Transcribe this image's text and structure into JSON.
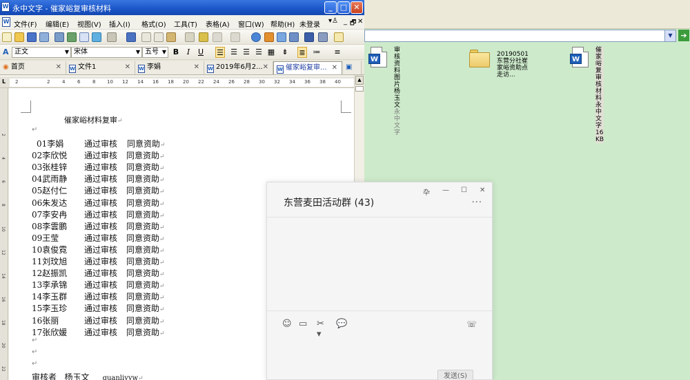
{
  "explorer": {
    "files": [
      {
        "name_line1": "审核资料图片  杨玉",
        "name_line2": "文",
        "sub": "永中文字"
      },
      {
        "name_line1": "20190501东营分社崔",
        "name_line2": "家峪资助点走访..."
      },
      {
        "name_line1": "催家峪复审核材料",
        "name_line2": "永中文字",
        "sub": "16 KB"
      }
    ]
  },
  "wp": {
    "title": "永中文字 - 催家峪复审核材料",
    "menu": [
      "文件(F)",
      "编辑(E)",
      "视图(V)",
      "插入(I)",
      "格式(O)",
      "工具(T)",
      "表格(A)",
      "窗口(W)",
      "帮助(H)"
    ],
    "login": "未登录",
    "style_value": "正文",
    "font_value": "宋体",
    "size_value": "五号",
    "tabs": [
      {
        "label": "首页"
      },
      {
        "label": "文件1"
      },
      {
        "label": "李娟"
      },
      {
        "label": "2019年6月2..."
      },
      {
        "label": "催家峪复审..."
      }
    ],
    "ruler_numbers": [
      "2",
      "2",
      "4",
      "6",
      "8",
      "10",
      "12",
      "14",
      "16",
      "18",
      "20",
      "22",
      "24",
      "26",
      "28",
      "30",
      "32",
      "34",
      "36",
      "38",
      "40"
    ],
    "vruler_numbers": [
      "2",
      "4",
      "6",
      "8",
      "10",
      "12",
      "14",
      "16",
      "18",
      "20",
      "22"
    ],
    "document": {
      "heading": "催家峪材料复审",
      "rows": [
        {
          "no": "01",
          "name": "李娟",
          "status": "通过审核",
          "result": "同意资助"
        },
        {
          "no": "02",
          "name": "李欣悦",
          "status": "通过审核",
          "result": "同意资助"
        },
        {
          "no": "03",
          "name": "张桂锌",
          "status": "通过审核",
          "result": "同意资助"
        },
        {
          "no": "04",
          "name": "武雨静",
          "status": "通过审核",
          "result": "同意资助"
        },
        {
          "no": "05",
          "name": "赵付仁",
          "status": "通过审核",
          "result": "同意资助"
        },
        {
          "no": "06",
          "name": "朱发达",
          "status": "通过审核",
          "result": "同意资助"
        },
        {
          "no": "07",
          "name": "李安冉",
          "status": "通过审核",
          "result": "同意资助"
        },
        {
          "no": "08",
          "name": "李雲鹏",
          "status": "通过审核",
          "result": "同意资助"
        },
        {
          "no": "09",
          "name": "王莹",
          "status": "通过审核",
          "result": "同意资助"
        },
        {
          "no": "10",
          "name": "袁俊霓",
          "status": "通过审核",
          "result": "同意资助"
        },
        {
          "no": "11",
          "name": "刘玟旭",
          "status": "通过审核",
          "result": "同意资助"
        },
        {
          "no": "12",
          "name": "赵振凯",
          "status": "通过审核",
          "result": "同意资助"
        },
        {
          "no": "13",
          "name": "李承锦",
          "status": "通过审核",
          "result": "同意资助"
        },
        {
          "no": "14",
          "name": "李玉群",
          "status": "通过审核",
          "result": "同意资助"
        },
        {
          "no": "15",
          "name": "李玉珍",
          "status": "通过审核",
          "result": "同意资助"
        },
        {
          "no": "16",
          "name": "张丽",
          "status": "通过审核",
          "result": "同意资助"
        },
        {
          "no": "17",
          "name": "张欣媛",
          "status": "通过审核",
          "result": "同意资助"
        }
      ],
      "reviewer_label": "审核者",
      "reviewer_name": "杨玉文",
      "reviewer_id": "quanliyyw"
    }
  },
  "chat": {
    "title": "东营麦田活动群",
    "count": "(43)",
    "send_label": "发送(S)"
  },
  "colors": {
    "desktop_bg": "#cdeacb",
    "titlebar": "#1a55c8",
    "word_blue": "#1f5fb8"
  }
}
